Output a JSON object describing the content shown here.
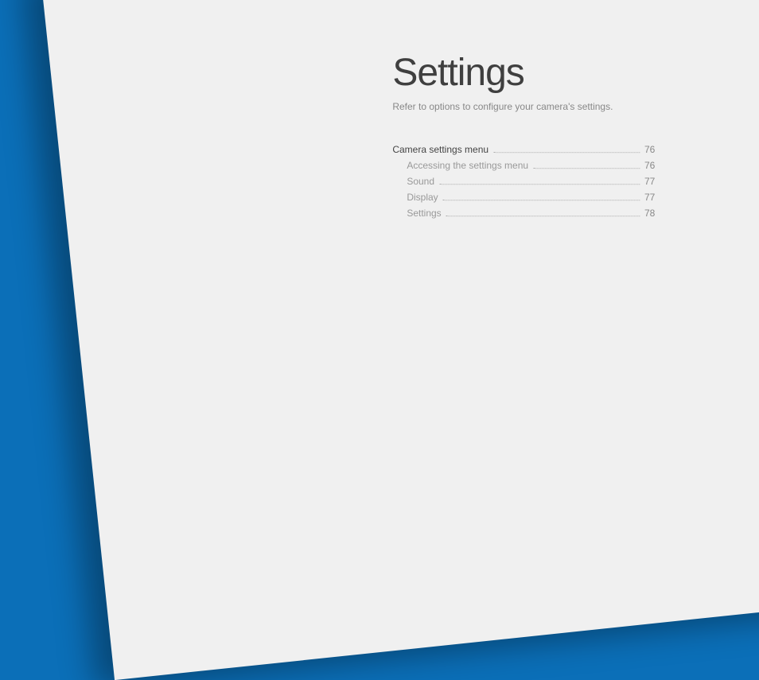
{
  "title": "Settings",
  "subtitle": "Refer to options to configure your camera's settings.",
  "toc": {
    "main": {
      "label": "Camera settings menu",
      "page": "76"
    },
    "subs": [
      {
        "label": "Accessing the settings menu",
        "page": "76"
      },
      {
        "label": "Sound",
        "page": "77"
      },
      {
        "label": "Display",
        "page": "77"
      },
      {
        "label": "Settings",
        "page": "78"
      }
    ]
  }
}
